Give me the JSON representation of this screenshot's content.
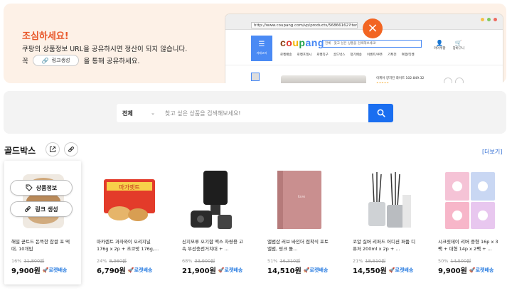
{
  "banner": {
    "title": "조심하세요!",
    "line1": "쿠팡의 상품정보 URL을 공유하시면 정산이 되지 않습니다.",
    "line2_prefix": "꼭",
    "link_button": "링크생성",
    "line2_suffix": "을 통해 공유하세요.",
    "accent_color": "#e8572a",
    "browser": {
      "url": "http://www.coupang.com/vp/products/56866162?itemId",
      "logo": "coupang",
      "menu_label": "카테고리",
      "search_category": "전체",
      "search_placeholder": "찾고 싶은 상품을 검색해보세요!",
      "nav_items": [
        "로켓배송",
        "로켓프레시",
        "로켓직구",
        "골드박스",
        "정기배송",
        "이벤트/쿠폰",
        "기획전",
        "여행/티켓"
      ],
      "icons": [
        {
          "icon": "user-icon",
          "label": "마이쿠팡"
        },
        {
          "icon": "cart-icon",
          "label": "장바구니"
        }
      ],
      "product_title": "이케아 양치킨 화이트 102.849.32"
    }
  },
  "search": {
    "category": "전체",
    "placeholder": "찾고 싶은 상품을 검색해보세요!",
    "button_color": "#1a6ef0"
  },
  "goldbox": {
    "title": "골드박스",
    "more": "[더보기]",
    "overlay": {
      "product_info": "상품정보",
      "link_create": "링크 생성"
    },
    "products": [
      {
        "name": "해밀 꾼트드 돈뜩한 찹쌀 포 떡대, 10개입",
        "discount": "16%",
        "original": "11,800원",
        "price": "9,900원",
        "delivery": "로켓배송"
      },
      {
        "name": "마카렌트 과자와이 오리지널 176g x 2p + 초코맛 176g,...",
        "discount": "24%",
        "original": "8,960원",
        "price": "6,790원",
        "delivery": "로켓배송"
      },
      {
        "name": "신지모루 오기합 맥스 차량용 고속 무선충전거치대 + ...",
        "discount": "68%",
        "original": "33,900원",
        "price": "21,900원",
        "delivery": "로켓배송"
      },
      {
        "name": "앨범샵 러브 바인더 접착식 포토앨범, 핑크 돌...",
        "discount": "51%",
        "original": "16,310원",
        "price": "14,510원",
        "delivery": "로켓배송"
      },
      {
        "name": "코알 실버 리퍼드 어디션 퍼퓸 디퓨저 200ml x 2p + ...",
        "discount": "21%",
        "original": "18,510원",
        "price": "14,550원",
        "delivery": "로켓배송"
      },
      {
        "name": "시크릿데이 리버 중형 16p x 3팩 + 대형 14p x 2팩 + ...",
        "discount": "50%",
        "original": "14,500원",
        "price": "9,900원",
        "delivery": "로켓배송"
      }
    ]
  }
}
